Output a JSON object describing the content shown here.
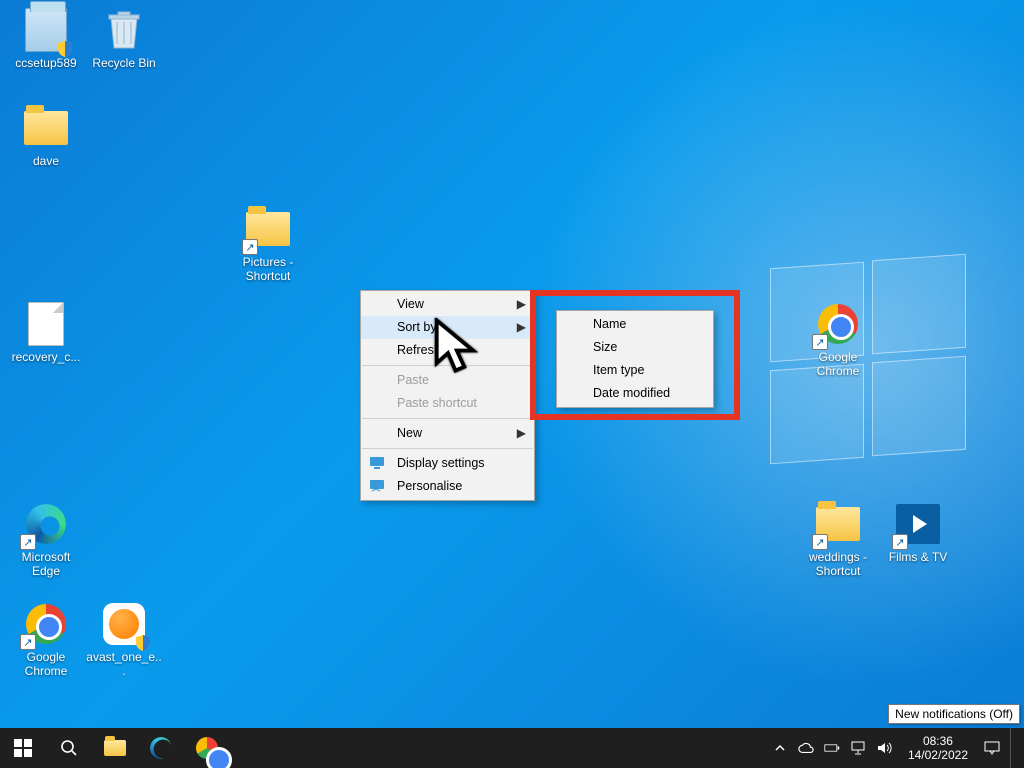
{
  "desktop_icons": {
    "ccsetup": {
      "label": "ccsetup589"
    },
    "recycle": {
      "label": "Recycle Bin"
    },
    "dave": {
      "label": "dave"
    },
    "pictures": {
      "label": "Pictures - Shortcut"
    },
    "recovery": {
      "label": "recovery_c..."
    },
    "edge": {
      "label": "Microsoft Edge"
    },
    "chrome_l": {
      "label": "Google Chrome"
    },
    "avast": {
      "label": "avast_one_e..."
    },
    "chrome_r": {
      "label": "Google Chrome"
    },
    "weddings": {
      "label": "weddings - Shortcut"
    },
    "filmtv": {
      "label": "Films & TV"
    }
  },
  "context_menu": {
    "view": "View",
    "sortby": "Sort by",
    "refresh": "Refresh",
    "paste": "Paste",
    "paste_shortcut": "Paste shortcut",
    "new": "New",
    "display": "Display settings",
    "personalise": "Personalise"
  },
  "sort_submenu": {
    "name": "Name",
    "size": "Size",
    "itemtype": "Item type",
    "datemod": "Date modified"
  },
  "tray": {
    "tooltip": "New notifications (Off)",
    "time": "08:36",
    "date": "14/02/2022"
  }
}
